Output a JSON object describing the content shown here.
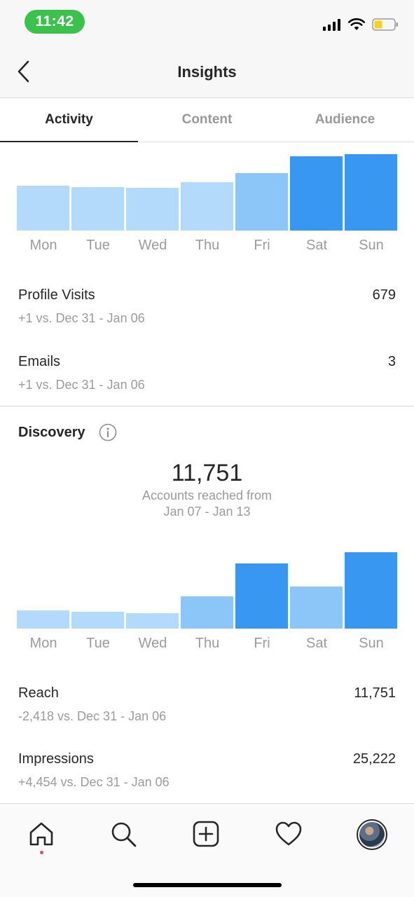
{
  "status_bar": {
    "time": "11:42"
  },
  "header": {
    "title": "Insights"
  },
  "tabs": [
    {
      "label": "Activity",
      "active": true
    },
    {
      "label": "Content",
      "active": false
    },
    {
      "label": "Audience",
      "active": false
    }
  ],
  "colors": {
    "bar_light": "#b3d9fb",
    "bar_mid": "#8cc5f8",
    "bar_dark": "#3897f0",
    "text_muted": "#9b9b9b",
    "accent_green": "#3bc24d"
  },
  "interactions": {
    "days": [
      "Mon",
      "Tue",
      "Wed",
      "Thu",
      "Fri",
      "Sat",
      "Sun"
    ],
    "bar_levels": [
      0.59,
      0.57,
      0.56,
      0.63,
      0.75,
      0.97,
      1.0
    ],
    "bar_shades": [
      "light",
      "light",
      "light",
      "light",
      "mid",
      "dark",
      "dark"
    ],
    "metrics": [
      {
        "title": "Profile Visits",
        "value": "679",
        "sub": "+1 vs. Dec 31 - Jan 06"
      },
      {
        "title": "Emails",
        "value": "3",
        "sub": "+1 vs. Dec 31 - Jan 06"
      }
    ]
  },
  "discovery": {
    "title": "Discovery",
    "info_icon": "info-circle-icon",
    "reach_value": "11,751",
    "caption_line1": "Accounts reached from",
    "caption_line2": "Jan 07 - Jan 13",
    "days": [
      "Mon",
      "Tue",
      "Wed",
      "Thu",
      "Fri",
      "Sat",
      "Sun"
    ],
    "bar_levels": [
      0.24,
      0.22,
      0.2,
      0.42,
      0.85,
      0.55,
      1.0
    ],
    "bar_shades": [
      "light",
      "light",
      "light",
      "mid",
      "dark",
      "mid",
      "dark"
    ],
    "metrics": [
      {
        "title": "Reach",
        "value": "11,751",
        "sub": "-2,418 vs. Dec 31 - Jan 06"
      },
      {
        "title": "Impressions",
        "value": "25,222",
        "sub": "+4,454 vs. Dec 31 - Jan 06"
      }
    ]
  },
  "bottom_nav": [
    {
      "name": "home",
      "icon": "home-icon",
      "selected": true
    },
    {
      "name": "search",
      "icon": "search-icon"
    },
    {
      "name": "new-post",
      "icon": "plus-square-icon"
    },
    {
      "name": "activity",
      "icon": "heart-icon"
    },
    {
      "name": "profile",
      "icon": "avatar"
    }
  ]
}
